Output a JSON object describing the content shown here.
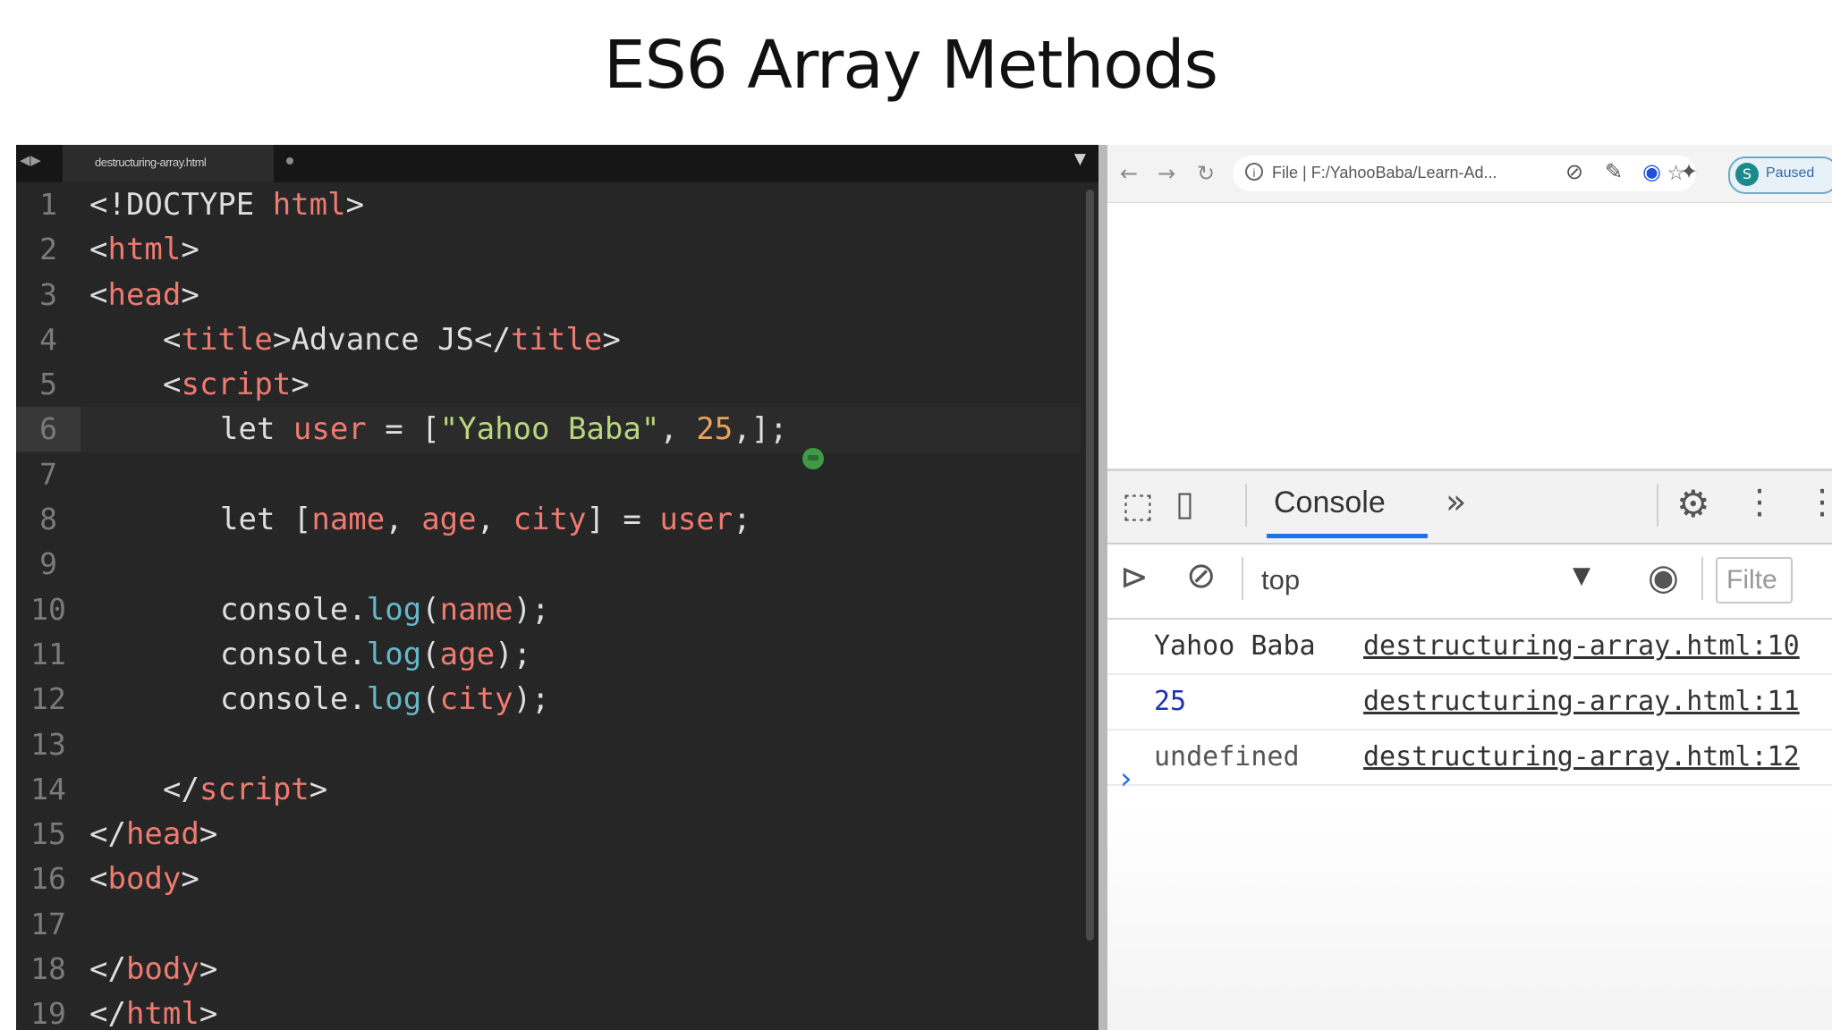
{
  "slide": {
    "title": "ES6 Array Methods"
  },
  "editor": {
    "tab_label": "destructuring-array.html",
    "lines": [
      {
        "n": "1"
      },
      {
        "n": "2"
      },
      {
        "n": "3"
      },
      {
        "n": "4"
      },
      {
        "n": "5"
      },
      {
        "n": "6"
      },
      {
        "n": "7"
      },
      {
        "n": "8"
      },
      {
        "n": "9"
      },
      {
        "n": "10"
      },
      {
        "n": "11"
      },
      {
        "n": "12"
      },
      {
        "n": "13"
      },
      {
        "n": "14"
      },
      {
        "n": "15"
      },
      {
        "n": "16"
      },
      {
        "n": "17"
      },
      {
        "n": "18"
      },
      {
        "n": "19"
      }
    ],
    "code": {
      "l1_a": "<!DOCTYPE ",
      "l1_b": "html",
      "l1_c": ">",
      "l2_a": "<",
      "l2_b": "html",
      "l2_c": ">",
      "l3_a": "<",
      "l3_b": "head",
      "l3_c": ">",
      "l4_a": "<",
      "l4_b": "title",
      "l4_c": ">Advance JS</",
      "l4_d": "title",
      "l4_e": ">",
      "l5_a": "<",
      "l5_b": "script",
      "l5_c": ">",
      "l6_a": "let ",
      "l6_b": "user",
      "l6_c": " = [",
      "l6_d": "\"Yahoo Baba\"",
      "l6_e": ", ",
      "l6_f": "25",
      "l6_g": ",];",
      "l8_a": "let [",
      "l8_b": "name",
      "l8_c": ", ",
      "l8_d": "age",
      "l8_e": ", ",
      "l8_f": "city",
      "l8_g": "] = ",
      "l8_h": "user",
      "l8_i": ";",
      "l10_a": "console.",
      "l10_b": "log",
      "l10_c": "(",
      "l10_d": "name",
      "l10_e": ");",
      "l11_a": "console.",
      "l11_b": "log",
      "l11_c": "(",
      "l11_d": "age",
      "l11_e": ");",
      "l12_a": "console.",
      "l12_b": "log",
      "l12_c": "(",
      "l12_d": "city",
      "l12_e": ");",
      "l14_a": "</",
      "l14_b": "script",
      "l14_c": ">",
      "l15_a": "</",
      "l15_b": "head",
      "l15_c": ">",
      "l16_a": "<",
      "l16_b": "body",
      "l16_c": ">",
      "l18_a": "</",
      "l18_b": "body",
      "l18_c": ">",
      "l19_a": "</",
      "l19_b": "html",
      "l19_c": ">"
    }
  },
  "browser": {
    "url_prefix": "File",
    "url_sep": "|",
    "url_path": "F:/YahooBaba/Learn-Ad...",
    "profile_initial": "S",
    "profile_status": "Paused"
  },
  "devtools": {
    "console_tab": "Console",
    "more_tabs": "»",
    "context": "top",
    "filter_placeholder": "Filte",
    "messages": [
      {
        "text": "Yahoo Baba",
        "source": "destructuring-array.html:10"
      },
      {
        "text": "25",
        "source": "destructuring-array.html:11"
      },
      {
        "text": "undefined",
        "source": "destructuring-array.html:12"
      }
    ],
    "prompt": "›"
  }
}
